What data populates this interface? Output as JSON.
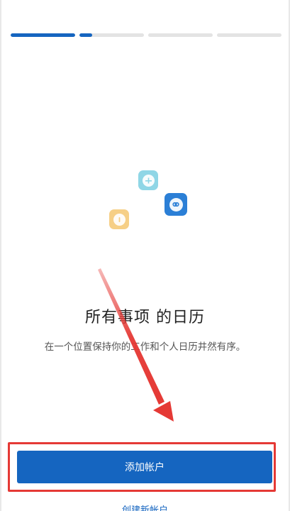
{
  "onboarding": {
    "steps_total": 4,
    "progress": [
      1.0,
      0.2,
      0.0,
      0.0
    ],
    "accent_color": "#1565c0",
    "heading": "所有事项 的日历",
    "description": "在一个位置保持你的工作和个人日历井然有序。",
    "icons": [
      "teal-app-icon",
      "blue-app-icon",
      "yellow-app-icon"
    ]
  },
  "actions": {
    "add_account_label": "添加帐户",
    "create_account_label": "创建新帐户"
  },
  "annotation": {
    "arrow_color": "#e53935",
    "highlight_color": "#e53935"
  }
}
